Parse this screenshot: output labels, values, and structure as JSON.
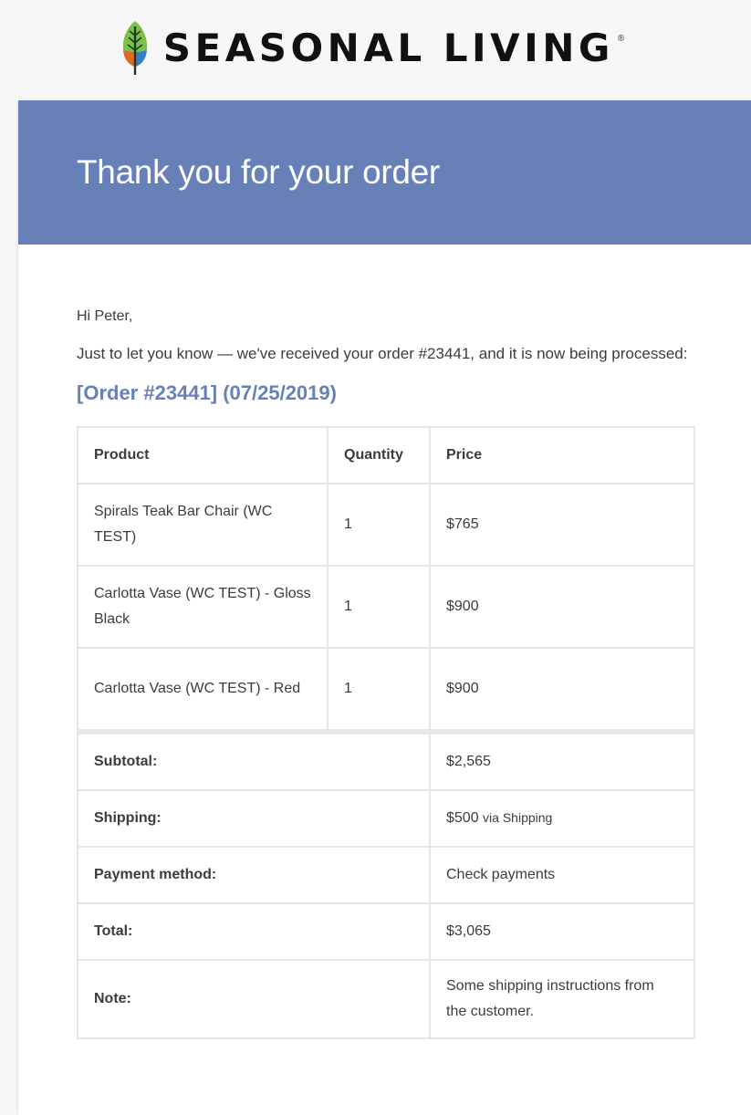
{
  "brand": {
    "name": "SEASONAL LIVING",
    "registered": "®"
  },
  "banner": {
    "title": "Thank you for your order"
  },
  "email": {
    "greeting": "Hi Peter,",
    "intro": "Just to let you know — we've received your order #23441, and it is now being processed:",
    "order_heading": "[Order #23441] (07/25/2019)"
  },
  "table": {
    "headers": [
      "Product",
      "Quantity",
      "Price"
    ],
    "items": [
      {
        "product": "Spirals Teak Bar Chair (WC TEST)",
        "quantity": "1",
        "price": "$765"
      },
      {
        "product": "Carlotta Vase (WC TEST) - Gloss Black",
        "quantity": "1",
        "price": "$900"
      },
      {
        "product": "Carlotta Vase (WC TEST) - Red",
        "quantity": "1",
        "price": "$900"
      }
    ],
    "totals": {
      "subtotal_label": "Subtotal:",
      "subtotal_value": "$2,565",
      "shipping_label": "Shipping:",
      "shipping_value": "$500",
      "shipping_method": "via Shipping",
      "payment_label": "Payment method:",
      "payment_value": "Check payments",
      "total_label": "Total:",
      "total_value": "$3,065",
      "note_label": "Note:",
      "note_value": "Some shipping instructions from the customer."
    }
  },
  "colors": {
    "accent": "#6781b8",
    "leaf_green": "#7cc24a",
    "leaf_orange": "#e0682b",
    "leaf_blue": "#3a7dc4"
  },
  "icons": {
    "logo": "tree-leaf-icon"
  }
}
